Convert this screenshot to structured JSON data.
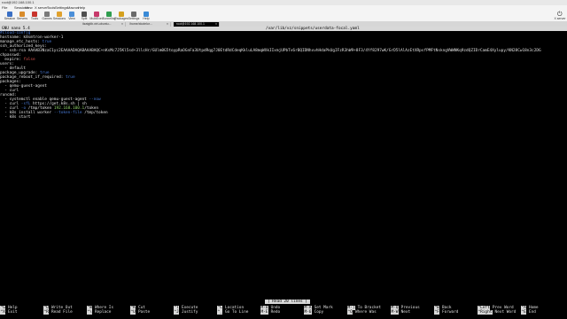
{
  "window": {
    "title": "root@192.168.100.1"
  },
  "menubar": [
    "File",
    "Sessions",
    "View",
    "X server",
    "Tools",
    "Settings",
    "Macros",
    "Help"
  ],
  "toolbar": {
    "buttons": [
      {
        "label": "Session",
        "color": "#3a6fc4"
      },
      {
        "label": "Servers",
        "color": "#d98c2b"
      },
      {
        "label": "Tools",
        "color": "#c8342c"
      },
      {
        "label": "Games",
        "color": "#7a7a7a"
      },
      {
        "label": "Sessions",
        "color": "#e0a12d"
      },
      {
        "label": "View",
        "color": "#4b8fd9"
      },
      {
        "label": "Split",
        "color": "#4f4f4f"
      },
      {
        "label": "MultiExec",
        "color": "#c73a6b"
      },
      {
        "label": "Tunneling",
        "color": "#2f9d4f"
      },
      {
        "label": "Packages",
        "color": "#d5a11f"
      },
      {
        "label": "Settings",
        "color": "#6a6a6a"
      },
      {
        "label": "Help",
        "color": "#3a8ad6"
      }
    ],
    "exit_label": "X server"
  },
  "tabs": [
    {
      "label": "itzatgtib.virt-ubuntu...",
      "active": false
    },
    {
      "label": "/home/xkotelor...",
      "active": false
    },
    {
      "label": "root@192.168.100.1",
      "active": true
    }
  ],
  "nano": {
    "version": "GNU nano 5.4",
    "filename": "/var/lib/vz/snippets/userdata-focal.yaml",
    "status": "[ Read 20 lines ]"
  },
  "file_lines": [
    [
      {
        "t": "#cloud-config",
        "c": "c-blue"
      }
    ],
    [
      {
        "t": "hostname: k8smtron-worker-1",
        "c": ""
      }
    ],
    [
      {
        "t": "manage_etc_hosts: ",
        "c": ""
      },
      {
        "t": "true",
        "c": "c-blue"
      }
    ],
    [
      {
        "t": "ssh_authorized_keys:",
        "c": ""
      }
    ],
    [
      {
        "t": "  - ssh-rsa AAAAB3NzaC1yc2EAAAADAQABAAABAQC+nKsMc7J5Kl5sd+3llcHr/GUlm0G5toypRaOGnFa3UtpdRqg7J0EtdRdCdeqKkluLA8mqWXkIIxmjUPbTv6rBQIDNhxvhHdaPkUgIFzR3hW9+8F3/4Yf8297wK/GrD5lAlAzEtXRpsfPMFtNskngVWWNKq9zdQZIDrCamE4Xylupy/KN28Cw18n3c2DG",
        "c": ""
      }
    ],
    [
      {
        "t": "chpasswd:",
        "c": ""
      }
    ],
    [
      {
        "t": "  expire: ",
        "c": ""
      },
      {
        "t": "false",
        "c": "c-red"
      }
    ],
    [
      {
        "t": "users:",
        "c": ""
      }
    ],
    [
      {
        "t": "  - default",
        "c": ""
      }
    ],
    [
      {
        "t": "package_upgrade: ",
        "c": ""
      },
      {
        "t": "true",
        "c": "c-blue"
      }
    ],
    [
      {
        "t": "package_reboot_if_required: ",
        "c": ""
      },
      {
        "t": "true",
        "c": "c-blue"
      }
    ],
    [
      {
        "t": "packages:",
        "c": ""
      }
    ],
    [
      {
        "t": "  - qemu-guest-agent",
        "c": ""
      }
    ],
    [
      {
        "t": "  - curl",
        "c": ""
      }
    ],
    [
      {
        "t": "runcmd:",
        "c": ""
      }
    ],
    [
      {
        "t": "  - systemctl enable qemu-guest-agent ",
        "c": ""
      },
      {
        "t": "--now",
        "c": "c-blue"
      }
    ],
    [
      {
        "t": "  - curl ",
        "c": ""
      },
      {
        "t": "-sfL",
        "c": "c-blue"
      },
      {
        "t": " https://get.k8s.sh | sh",
        "c": ""
      }
    ],
    [
      {
        "t": "  - curl ",
        "c": ""
      },
      {
        "t": "-o",
        "c": "c-blue"
      },
      {
        "t": " /tmp/token ",
        "c": ""
      },
      {
        "t": "192.168.100.1",
        "c": "c-green"
      },
      {
        "t": "/token",
        "c": ""
      }
    ],
    [
      {
        "t": "  - k8s install worker ",
        "c": ""
      },
      {
        "t": "--token-file",
        "c": "c-blue"
      },
      {
        "t": " /tmp/token",
        "c": ""
      }
    ],
    [
      {
        "t": "  - k8s start",
        "c": ""
      }
    ]
  ],
  "shortcuts": [
    {
      "key": "^G",
      "label": "Help"
    },
    {
      "key": "^X",
      "label": "Exit"
    },
    {
      "key": "^O",
      "label": "Write Out"
    },
    {
      "key": "^R",
      "label": "Read File"
    },
    {
      "key": "^W",
      "label": "Where Is"
    },
    {
      "key": "^\\",
      "label": "Replace"
    },
    {
      "key": "^K",
      "label": "Cut"
    },
    {
      "key": "^U",
      "label": "Paste"
    },
    {
      "key": "^T",
      "label": "Execute"
    },
    {
      "key": "^J",
      "label": "Justify"
    },
    {
      "key": "^C",
      "label": "Location"
    },
    {
      "key": "^_",
      "label": "Go To Line"
    },
    {
      "key": "M-U",
      "label": "Undo"
    },
    {
      "key": "M-E",
      "label": "Redo"
    },
    {
      "key": "M-A",
      "label": "Set Mark"
    },
    {
      "key": "M-6",
      "label": "Copy"
    },
    {
      "key": "M-]",
      "label": "To Bracket"
    },
    {
      "key": "^Q",
      "label": "Where Was"
    },
    {
      "key": "M-Q",
      "label": "Previous"
    },
    {
      "key": "M-W",
      "label": "Next"
    },
    {
      "key": "^B",
      "label": "Back"
    },
    {
      "key": "^F",
      "label": "Forward"
    },
    {
      "key": "^Left",
      "label": "Prev Word"
    },
    {
      "key": "^Right",
      "label": "Next Word"
    },
    {
      "key": "^A",
      "label": "Home"
    },
    {
      "key": "^E",
      "label": "End"
    }
  ]
}
